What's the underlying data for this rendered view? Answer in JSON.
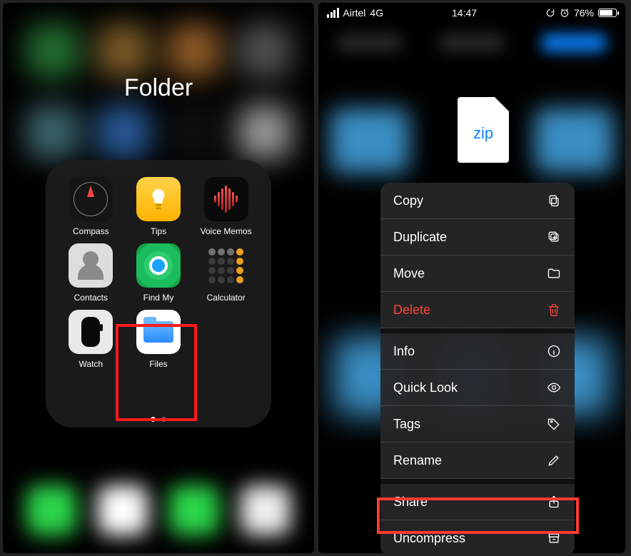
{
  "left": {
    "folder_title": "Folder",
    "apps": [
      {
        "label": "Compass",
        "icon": "compass"
      },
      {
        "label": "Tips",
        "icon": "tips"
      },
      {
        "label": "Voice Memos",
        "icon": "voice"
      },
      {
        "label": "Contacts",
        "icon": "contacts"
      },
      {
        "label": "Find My",
        "icon": "findmy"
      },
      {
        "label": "Calculator",
        "icon": "calc"
      },
      {
        "label": "Watch",
        "icon": "watch"
      },
      {
        "label": "Files",
        "icon": "files"
      }
    ],
    "page_index": 0,
    "page_count": 2,
    "highlight": "Files"
  },
  "right": {
    "status": {
      "carrier": "Airtel",
      "network": "4G",
      "time": "14:47",
      "battery_label": "76%",
      "alarm": true
    },
    "file": {
      "ext": "zip"
    },
    "menu": [
      {
        "label": "Copy",
        "icon": "copy"
      },
      {
        "label": "Duplicate",
        "icon": "duplicate"
      },
      {
        "label": "Move",
        "icon": "move"
      },
      {
        "label": "Delete",
        "icon": "delete",
        "destructive": true
      },
      {
        "label": "Info",
        "icon": "info",
        "sep": true
      },
      {
        "label": "Quick Look",
        "icon": "eye"
      },
      {
        "label": "Tags",
        "icon": "tag"
      },
      {
        "label": "Rename",
        "icon": "pencil"
      },
      {
        "label": "Share",
        "icon": "share",
        "sep": true
      },
      {
        "label": "Uncompress",
        "icon": "archive"
      }
    ],
    "highlight": "Uncompress"
  }
}
